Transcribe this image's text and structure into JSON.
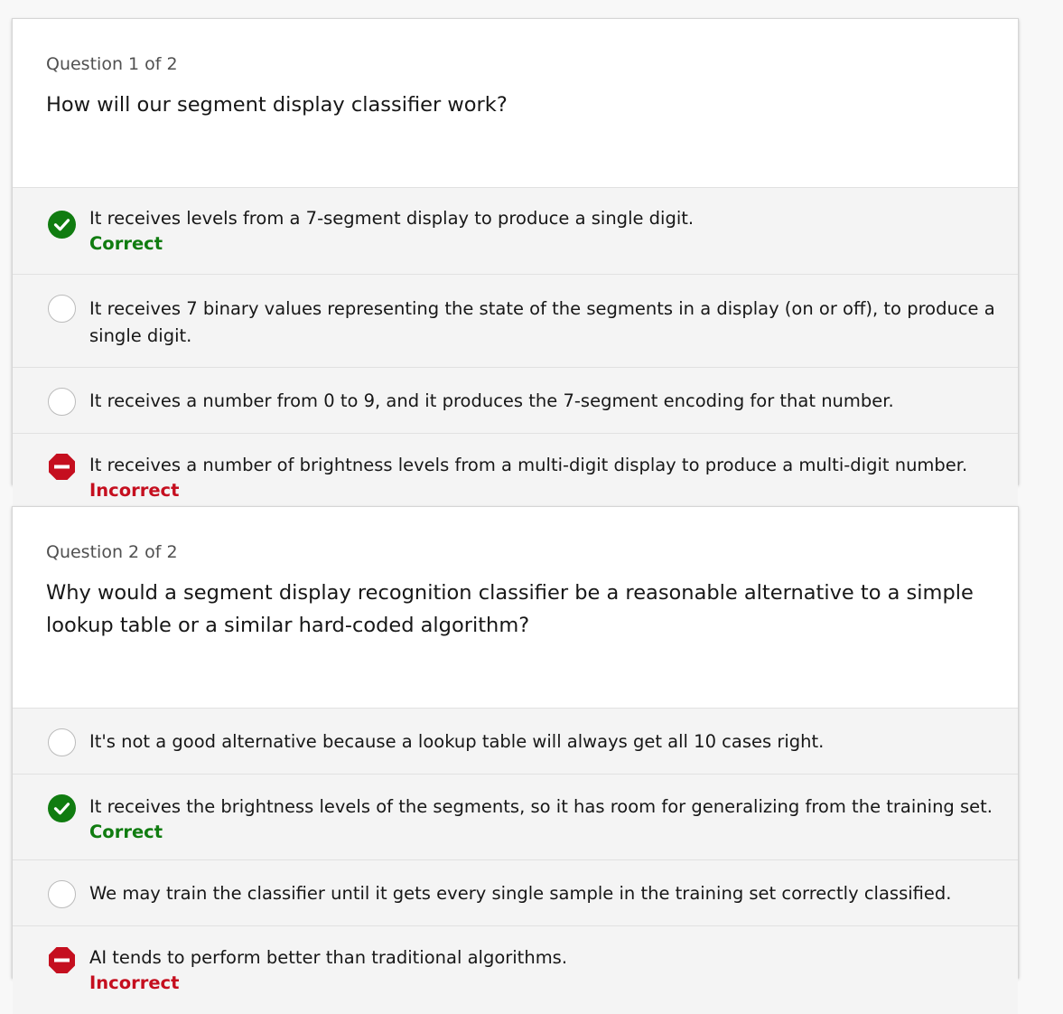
{
  "questions": [
    {
      "counter": "Question 1 of 2",
      "text": "How will our segment display classifier work?",
      "options": [
        {
          "text": "It receives levels from a 7-segment display to produce a single digit.",
          "state": "correct",
          "status": "Correct",
          "icon": "check-circle-icon"
        },
        {
          "text": "It receives 7 binary values representing the state of the segments in a display (on or off), to produce a single digit.",
          "state": "unselected",
          "status": "",
          "icon": "radio-icon"
        },
        {
          "text": "It receives a number from 0 to 9, and it produces the 7-segment encoding for that number.",
          "state": "unselected",
          "status": "",
          "icon": "radio-icon"
        },
        {
          "text": "It receives a number of brightness levels from a multi-digit display to produce a multi-digit number.",
          "state": "incorrect",
          "status": "Incorrect",
          "icon": "stop-icon"
        }
      ]
    },
    {
      "counter": "Question 2 of 2",
      "text": "Why would a segment display recognition classifier be a reasonable alternative to a simple lookup table or a similar hard-coded algorithm?",
      "options": [
        {
          "text": "It's not a good alternative because a lookup table will always get all 10 cases right.",
          "state": "unselected",
          "status": "",
          "icon": "radio-icon"
        },
        {
          "text": "It receives the brightness levels of the segments, so it has room for generalizing from the training set.",
          "state": "correct",
          "status": "Correct",
          "icon": "check-circle-icon"
        },
        {
          "text": "We may train the classifier until it gets every single sample in the training set correctly classified.",
          "state": "unselected",
          "status": "",
          "icon": "radio-icon"
        },
        {
          "text": "AI tends to perform better than traditional algorithms.",
          "state": "incorrect",
          "status": "Incorrect",
          "icon": "stop-icon"
        }
      ]
    }
  ],
  "colors": {
    "correct": "#107c10",
    "incorrect": "#c50f1f",
    "background": "#f8f8f8"
  }
}
